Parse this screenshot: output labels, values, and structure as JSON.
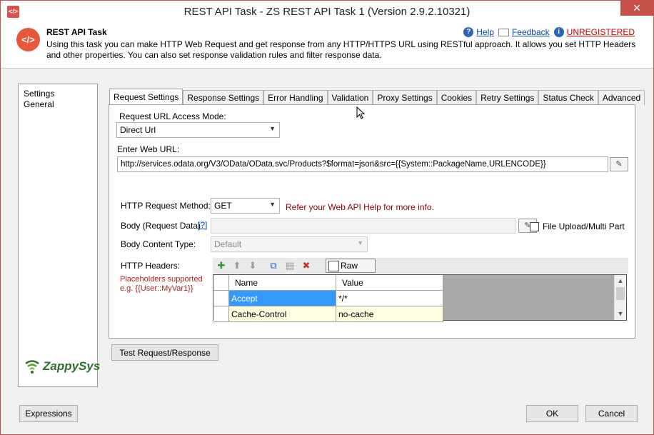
{
  "window": {
    "title": "REST API Task - ZS REST API Task 1 (Version 2.9.2.10321)",
    "close_glyph": "✕",
    "app_icon_glyph": "</>"
  },
  "header": {
    "title": "REST API Task",
    "description": "Using this task you can make HTTP Web Request and get response from any HTTP/HTTPS URL using RESTful approach. It allows you set HTTP Headers and other properties. You can also set response validation rules and filter response data.",
    "help_label": "Help",
    "feedback_label": "Feedback",
    "unregistered_label": "UNREGISTERED"
  },
  "left_nav": {
    "items": [
      {
        "label": "Settings"
      },
      {
        "label": "General"
      }
    ],
    "brand": "ZappySys"
  },
  "tabs": [
    {
      "label": "Request Settings",
      "active": true
    },
    {
      "label": "Response Settings",
      "active": false
    },
    {
      "label": "Error Handling",
      "active": false
    },
    {
      "label": "Validation",
      "active": false
    },
    {
      "label": "Proxy Settings",
      "active": false
    },
    {
      "label": "Cookies",
      "active": false
    },
    {
      "label": "Retry Settings",
      "active": false
    },
    {
      "label": "Status Check",
      "active": false
    },
    {
      "label": "Advanced",
      "active": false
    }
  ],
  "form": {
    "access_mode_label": "Request URL Access Mode:",
    "access_mode_value": "Direct Url",
    "url_label": "Enter Web URL:",
    "url_value": "http://services.odata.org/V3/OData/OData.svc/Products?$format=json&src={{System::PackageName,URLENCODE}}",
    "method_label": "HTTP Request Method:",
    "method_value": "GET",
    "method_hint": "Refer your Web API Help for more info.",
    "body_label": "Body (Request Data)",
    "body_help": "[?]",
    "body_value": "",
    "file_upload_label": "File Upload/Multi Part",
    "content_type_label": "Body Content Type:",
    "content_type_value": "Default",
    "headers_label": "HTTP Headers:",
    "placeholder_note_line1": "Placeholders supported",
    "placeholder_note_line2": "e.g. {{User::MyVar1}}",
    "raw_edit_label": "Raw Edit"
  },
  "headers_grid": {
    "columns": [
      "Name",
      "Value"
    ],
    "rows": [
      {
        "name": "Accept",
        "value": "*/*"
      },
      {
        "name": "Cache-Control",
        "value": "no-cache"
      }
    ]
  },
  "buttons": {
    "test": "Test Request/Response",
    "expressions": "Expressions",
    "ok": "OK",
    "cancel": "Cancel"
  },
  "colors": {
    "accent_red": "#c7504b",
    "link_blue": "#0645ad",
    "selected_cell": "#3399ff",
    "value_cell": "#ffffe1",
    "brand_green": "#2c6f2c"
  }
}
